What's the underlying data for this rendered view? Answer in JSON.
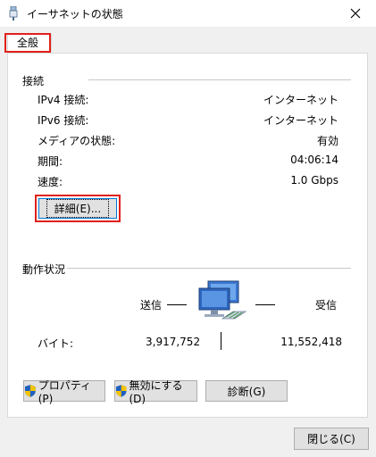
{
  "window": {
    "title": "イーサネットの状態",
    "icons": {
      "app": "network-adapter-icon",
      "close": "close-icon"
    }
  },
  "tabs": [
    {
      "label": "全般",
      "selected": true
    }
  ],
  "connection": {
    "group_title": "接続",
    "rows": [
      {
        "label": "IPv4 接続:",
        "value": "インターネット"
      },
      {
        "label": "IPv6 接続:",
        "value": "インターネット"
      },
      {
        "label": "メディアの状態:",
        "value": "有効"
      },
      {
        "label": "期間:",
        "value": "04:06:14"
      },
      {
        "label": "速度:",
        "value": "1.0 Gbps"
      }
    ],
    "details_button": "詳細(E)..."
  },
  "activity": {
    "group_title": "動作状況",
    "sent_label": "送信",
    "received_label": "受信",
    "bytes_label": "バイト:",
    "bytes_sent": "3,917,752",
    "bytes_received": "11,552,418",
    "icon": "network-computers-icon"
  },
  "buttons": {
    "properties": "プロパティ(P)",
    "disable": "無効にする(D)",
    "diagnose": "診断(G)",
    "close": "閉じる(C)"
  },
  "colors": {
    "highlight_outline": "#e0201a",
    "focus_border": "#0078d7",
    "shield_blue": "#1f5fbf",
    "shield_yellow": "#f4c400"
  }
}
